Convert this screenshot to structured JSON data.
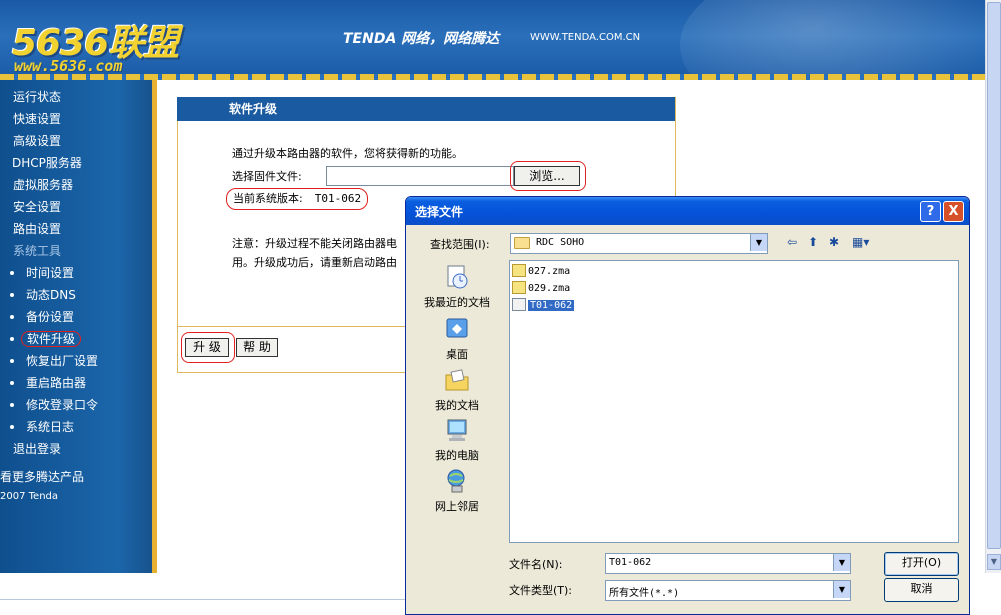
{
  "header": {
    "logo": "5636联盟",
    "logo_site": "www.5636.com",
    "slogan": "TENDA 网络，网络腾达",
    "site_url": "WWW.TENDA.COM.CN"
  },
  "sidebar": {
    "items": [
      {
        "label": "运行状态"
      },
      {
        "label": "快速设置"
      },
      {
        "label": "高级设置"
      },
      {
        "label": "DHCP服务器"
      },
      {
        "label": "虚拟服务器"
      },
      {
        "label": "安全设置"
      },
      {
        "label": "路由设置"
      },
      {
        "label": "系统工具"
      },
      {
        "label": "时间设置"
      },
      {
        "label": "动态DNS"
      },
      {
        "label": "备份设置"
      },
      {
        "label": "软件升级"
      },
      {
        "label": "恢复出厂设置"
      },
      {
        "label": "重启路由器"
      },
      {
        "label": "修改登录口令"
      },
      {
        "label": "系统日志"
      },
      {
        "label": "退出登录"
      }
    ],
    "more_products": "看更多腾达产品",
    "copyright": "2007 Tenda"
  },
  "panel": {
    "title": "软件升级",
    "intro": "通过升级本路由器的软件，您将获得新的功能。",
    "file_label": "选择固件文件:",
    "browse_label": "浏览...",
    "version_label": "当前系统版本:",
    "version_value": "T01-062",
    "notice_line1": "注意：升级过程不能关闭路由器电",
    "notice_line2": "用。升级成功后，请重新启动路由",
    "upgrade_label": "升 级",
    "help_label": "帮 助"
  },
  "dialog": {
    "title": "选择文件",
    "help_btn": "?",
    "close_btn": "X",
    "look_in_label": "查找范围(I):",
    "look_in_value": "RDC SOHO",
    "places": [
      {
        "label": "我最近的文档",
        "icon": "recent-documents-icon"
      },
      {
        "label": "桌面",
        "icon": "desktop-icon"
      },
      {
        "label": "我的文档",
        "icon": "my-documents-icon"
      },
      {
        "label": "我的电脑",
        "icon": "my-computer-icon"
      },
      {
        "label": "网上邻居",
        "icon": "network-places-icon"
      }
    ],
    "files": [
      {
        "name": "027.zma"
      },
      {
        "name": "029.zma"
      },
      {
        "name": "T01-062"
      }
    ],
    "file_name_label": "文件名(N):",
    "file_name_value": "T01-062",
    "file_type_label": "文件类型(T):",
    "file_type_value": "所有文件(*.*)",
    "open_label": "打开(O)",
    "cancel_label": "取消"
  },
  "colors": {
    "header_blue": "#1a5aa6",
    "sidebar_blue": "#1b66aa",
    "panel_title_blue": "#1a5aa0",
    "highlight_red": "#e02020",
    "xp_title_blue": "#0552d8",
    "selection_blue": "#316ac5"
  }
}
